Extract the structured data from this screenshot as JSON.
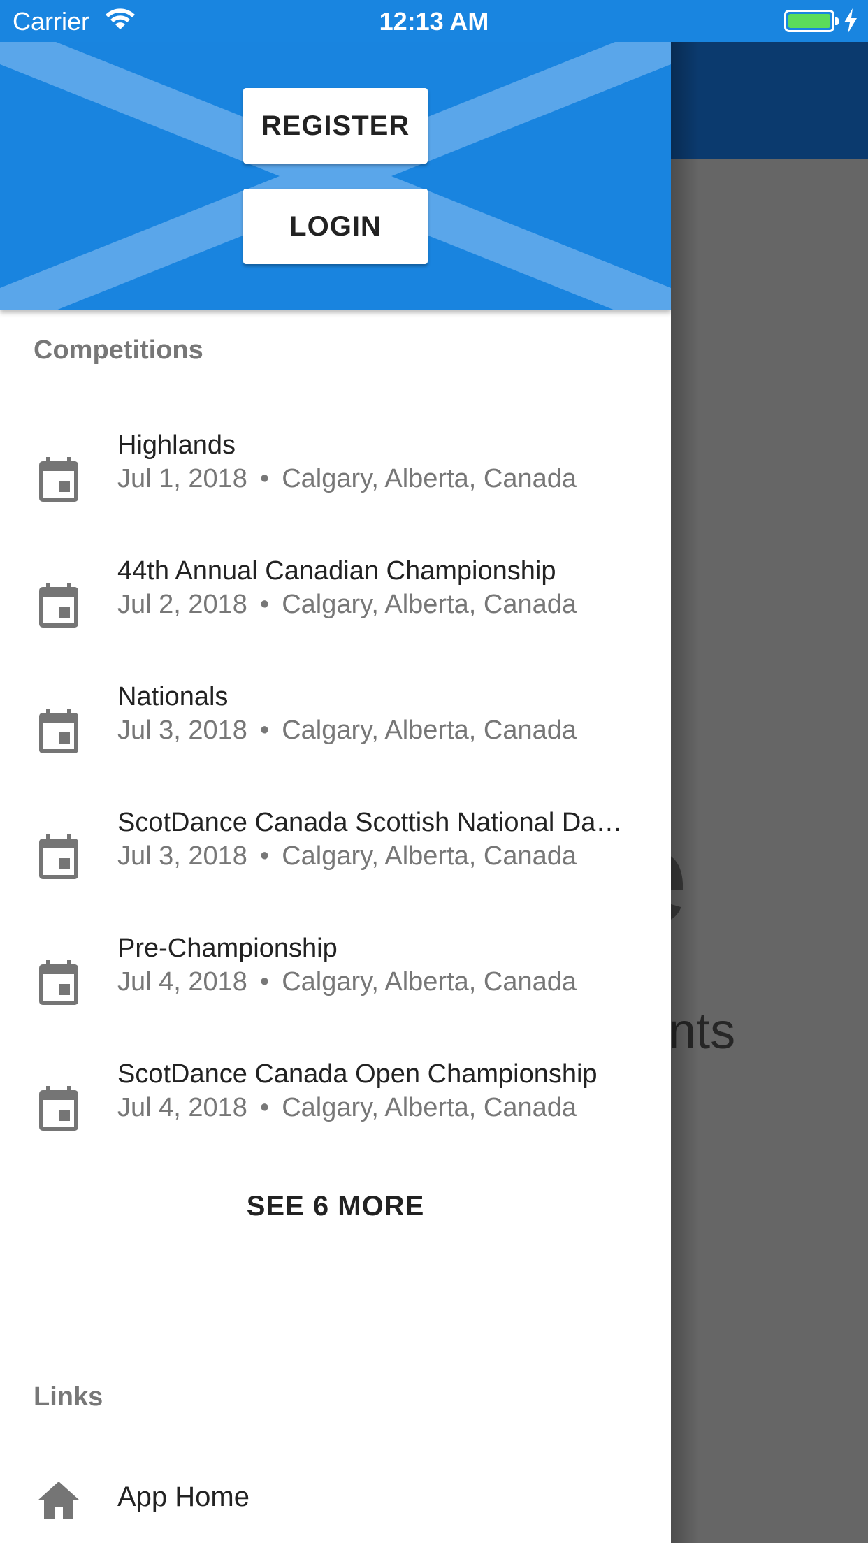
{
  "status_bar": {
    "carrier": "Carrier",
    "time": "12:13 AM",
    "icons": [
      "wifi-icon",
      "battery-icon",
      "charging-bolt-icon"
    ]
  },
  "background_app": {
    "partial_heading": "e",
    "partial_text": "vents"
  },
  "drawer": {
    "header": {
      "register_label": "REGISTER",
      "login_label": "LOGIN"
    },
    "competitions_label": "Competitions",
    "competitions": [
      {
        "title": "Highlands",
        "date": "Jul 1, 2018",
        "location": "Calgary, Alberta, Canada",
        "icon": "calendar-icon"
      },
      {
        "title": "44th Annual Canadian Championship",
        "date": "Jul 2, 2018",
        "location": "Calgary, Alberta, Canada",
        "icon": "calendar-icon"
      },
      {
        "title": "Nationals",
        "date": "Jul 3, 2018",
        "location": "Calgary, Alberta, Canada",
        "icon": "calendar-icon"
      },
      {
        "title": "ScotDance Canada Scottish National Dan…",
        "date": "Jul 3, 2018",
        "location": "Calgary, Alberta, Canada",
        "icon": "calendar-icon"
      },
      {
        "title": "Pre-Championship",
        "date": "Jul 4, 2018",
        "location": "Calgary, Alberta, Canada",
        "icon": "calendar-icon"
      },
      {
        "title": "ScotDance Canada Open Championship",
        "date": "Jul 4, 2018",
        "location": "Calgary, Alberta, Canada",
        "icon": "calendar-icon"
      }
    ],
    "separator": "•",
    "see_more_label": "SEE 6 MORE",
    "links_label": "Links",
    "links": [
      {
        "label": "App Home",
        "icon": "home-icon"
      }
    ]
  },
  "colors": {
    "header_blue": "#1984df",
    "saltire_light": "#5aa6ea",
    "status_bar_blue": "#1985e0",
    "app_bar_dark": "#0b3a6e",
    "scrim_gray": "#666666"
  }
}
